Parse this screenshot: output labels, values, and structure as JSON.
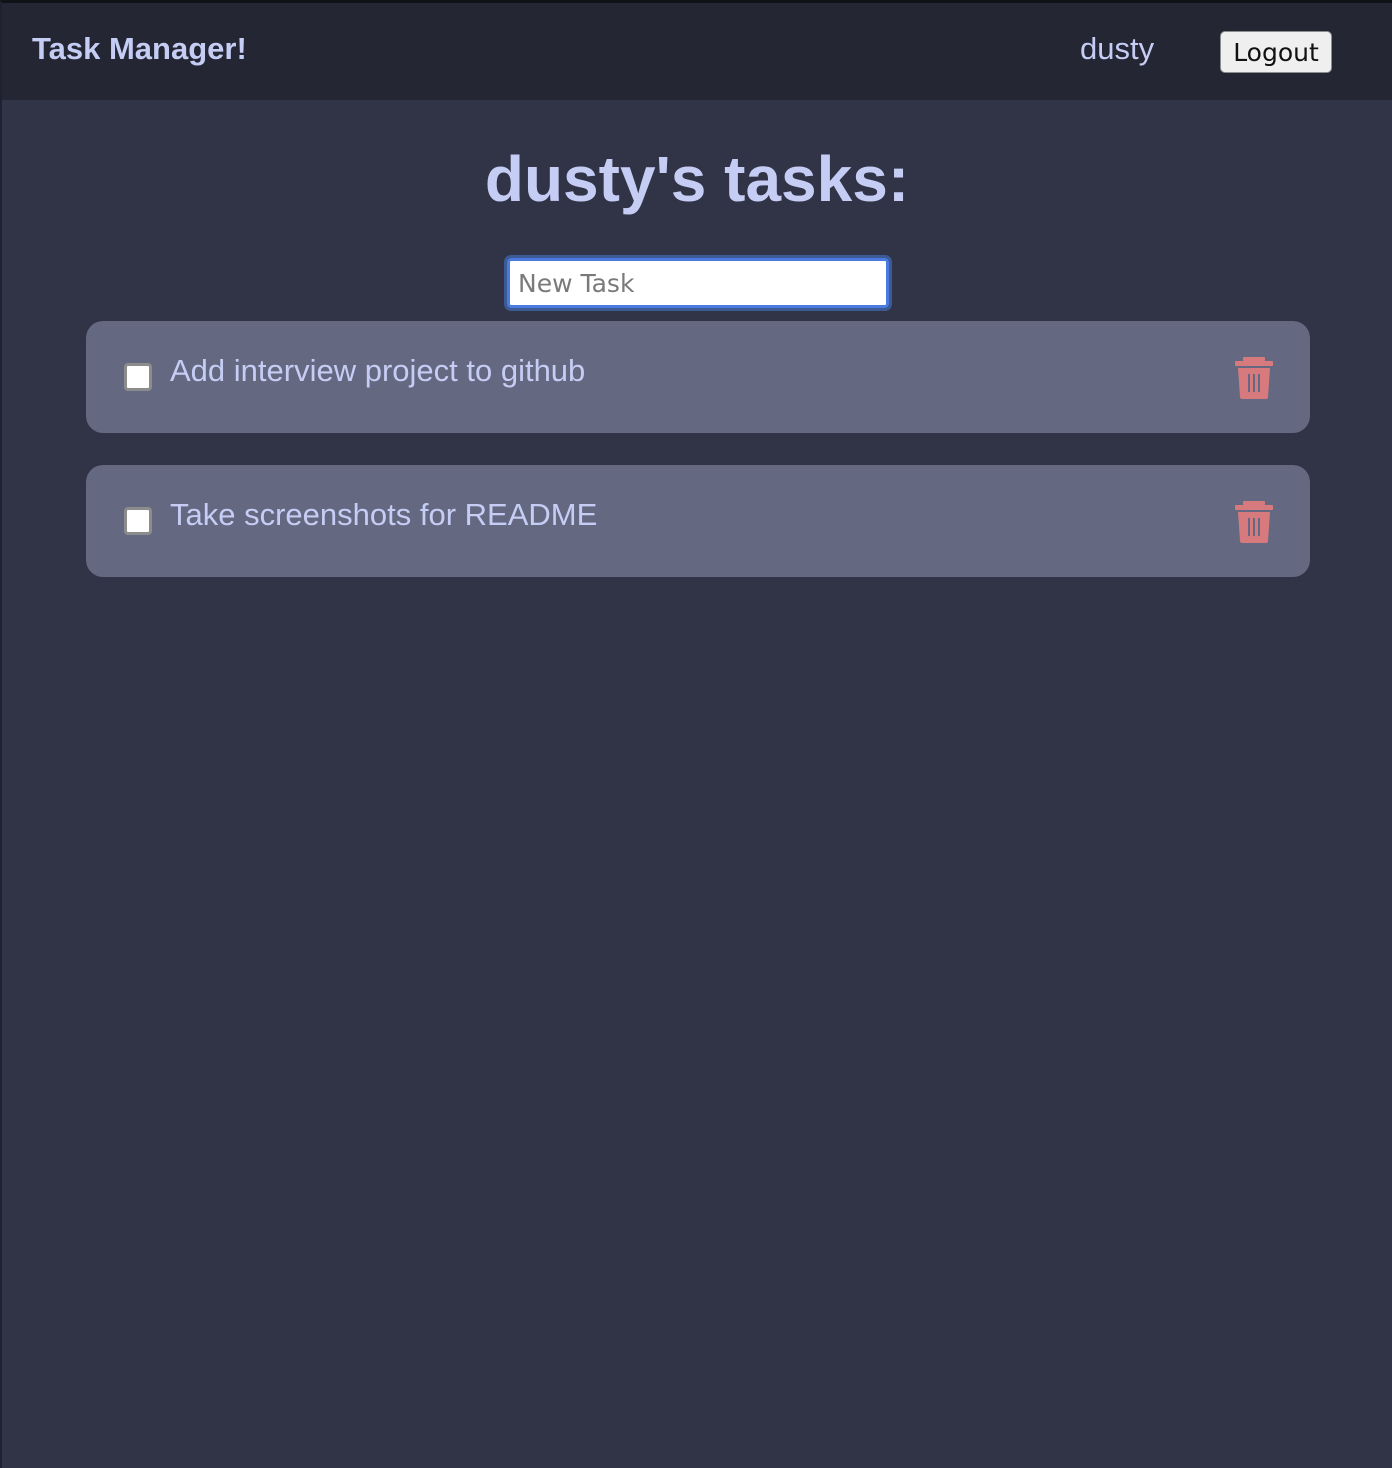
{
  "navbar": {
    "brand": "Task Manager!",
    "username": "dusty",
    "logout_label": "Logout"
  },
  "main": {
    "title": "dusty's tasks:",
    "new_task": {
      "placeholder": "New Task",
      "value": ""
    },
    "tasks": [
      {
        "text": "Add interview project to github",
        "done": false
      },
      {
        "text": "Take screenshots for README",
        "done": false
      }
    ]
  },
  "icons": {
    "delete": "trash-icon"
  },
  "colors": {
    "background": "#313447",
    "navbar": "#242633",
    "card": "#646880",
    "text": "#c6cdf5",
    "delete": "#d77a7e",
    "focus": "#4b7be0"
  }
}
